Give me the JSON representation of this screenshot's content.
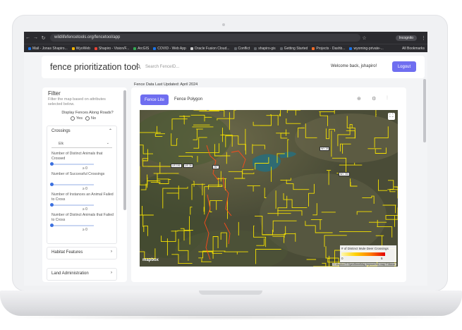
{
  "browser": {
    "url": "wildlifefencetools.org/fencetool/app",
    "incognito_label": "Incognito",
    "bookmarks": [
      {
        "label": "Mail - Jonas Shapiro...",
        "color": "#1a73e8"
      },
      {
        "label": "WyoWeb",
        "color": "#f4b400"
      },
      {
        "label": "Shapiro - Vision/F...",
        "color": "#ea4335"
      },
      {
        "label": "ArcGIS",
        "color": "#34a853"
      },
      {
        "label": "COVID - Web App",
        "color": "#1a73e8"
      },
      {
        "label": "Oracle Fusion Cloud...",
        "color": "#cccccc"
      },
      {
        "label": "Conflict",
        "color": "#5f6368"
      },
      {
        "label": "shapiro-gis",
        "color": "#5f6368"
      },
      {
        "label": "Getting Started",
        "color": "#5f6368"
      },
      {
        "label": "Projects · Dashb...",
        "color": "#fc6d26"
      },
      {
        "label": "wyoming-private-...",
        "color": "#1a73e8"
      }
    ],
    "all_bookmarks": "All Bookmarks"
  },
  "header": {
    "app_title": "fence prioritization tool",
    "search_placeholder": "Search FenceID...",
    "welcome": "Welcome back, jshapiro!",
    "logout_label": "Logout"
  },
  "fence_date": "Fence Data Last Updated: April 2024",
  "filter": {
    "title": "Filter",
    "subtitle": "Filter the map based on attributes selected below.",
    "roads_question": "Display Fences Along Roads?",
    "yes_label": "Yes",
    "no_label": "No",
    "crossings_title": "Crossings",
    "species_value": "Elk",
    "criteria": [
      {
        "label": "Number of Distinct Animals that Crossed",
        "ge": "≥ 0"
      },
      {
        "label": "Number of Successful Crossings",
        "ge": "≥ 0"
      },
      {
        "label": "Number of Instances an Animal Failed to Cross",
        "ge": "≥ 0"
      },
      {
        "label": "Number of Distinct Animals that Failed to Cross",
        "ge": "≥ 0"
      }
    ],
    "habitat_title": "Habitat Features",
    "land_title": "Land Administration"
  },
  "map": {
    "tabs": [
      "Fence Lite",
      "Fence Polygon"
    ],
    "legend_title": "# of Distinct Mule Deer Crossings",
    "legend_min": "0",
    "legend_max": "6",
    "logo": "mapbox",
    "attribution": "© Mapbox © OpenStreetMap Improve this map © Maxar",
    "colors": {
      "low": "#fff9b0",
      "mid": "#ffd000",
      "high": "#e30000",
      "accent": "#6f6ef0"
    },
    "road_labels": [
      "US 191",
      "US 26",
      "287",
      "WY 28",
      "WY 789"
    ]
  }
}
